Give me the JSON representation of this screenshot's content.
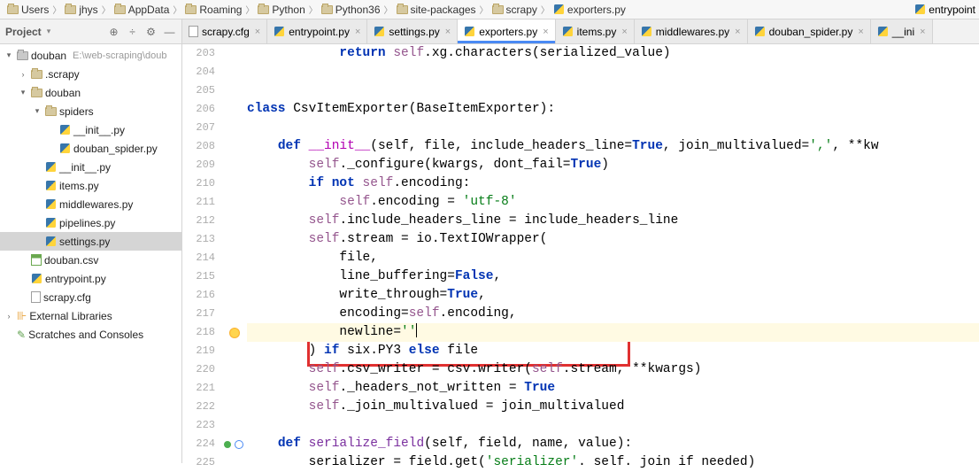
{
  "breadcrumb": {
    "items": [
      "Users",
      "jhys",
      "AppData",
      "Roaming",
      "Python",
      "Python36",
      "site-packages",
      "scrapy"
    ],
    "file": "exporters.py",
    "right": "entrypoint"
  },
  "projectHeader": {
    "title": "Project",
    "dropdown": "▾"
  },
  "tabs": [
    {
      "label": "scrapy.cfg",
      "type": "file",
      "active": false
    },
    {
      "label": "entrypoint.py",
      "type": "py",
      "active": false
    },
    {
      "label": "settings.py",
      "type": "py",
      "active": false
    },
    {
      "label": "exporters.py",
      "type": "py",
      "active": true
    },
    {
      "label": "items.py",
      "type": "py",
      "active": false
    },
    {
      "label": "middlewares.py",
      "type": "py",
      "active": false
    },
    {
      "label": "douban_spider.py",
      "type": "py",
      "active": false
    },
    {
      "label": "__ini",
      "type": "py",
      "active": false
    }
  ],
  "tree": [
    {
      "depth": 0,
      "twisty": "▾",
      "icon": "folder-proj",
      "label": "douban",
      "muted": "E:\\web-scraping\\doub"
    },
    {
      "depth": 1,
      "twisty": "›",
      "icon": "folder",
      "label": ".scrapy",
      "muted": ""
    },
    {
      "depth": 1,
      "twisty": "▾",
      "icon": "folder",
      "label": "douban",
      "muted": ""
    },
    {
      "depth": 2,
      "twisty": "▾",
      "icon": "folder",
      "label": "spiders",
      "muted": ""
    },
    {
      "depth": 3,
      "twisty": "",
      "icon": "py",
      "label": "__init__.py",
      "muted": ""
    },
    {
      "depth": 3,
      "twisty": "",
      "icon": "py",
      "label": "douban_spider.py",
      "muted": ""
    },
    {
      "depth": 2,
      "twisty": "",
      "icon": "py",
      "label": "__init__.py",
      "muted": ""
    },
    {
      "depth": 2,
      "twisty": "",
      "icon": "py",
      "label": "items.py",
      "muted": ""
    },
    {
      "depth": 2,
      "twisty": "",
      "icon": "py",
      "label": "middlewares.py",
      "muted": ""
    },
    {
      "depth": 2,
      "twisty": "",
      "icon": "py",
      "label": "pipelines.py",
      "muted": ""
    },
    {
      "depth": 2,
      "twisty": "",
      "icon": "py",
      "label": "settings.py",
      "muted": "",
      "selected": true
    },
    {
      "depth": 1,
      "twisty": "",
      "icon": "csv",
      "label": "douban.csv",
      "muted": ""
    },
    {
      "depth": 1,
      "twisty": "",
      "icon": "py",
      "label": "entrypoint.py",
      "muted": ""
    },
    {
      "depth": 1,
      "twisty": "",
      "icon": "file",
      "label": "scrapy.cfg",
      "muted": ""
    },
    {
      "depth": 0,
      "twisty": "›",
      "icon": "lib",
      "label": "External Libraries",
      "muted": ""
    },
    {
      "depth": 0,
      "twisty": "",
      "icon": "scratch",
      "label": "Scratches and Consoles",
      "muted": ""
    }
  ],
  "lineStart": 203,
  "code": {
    "l203": {
      "pre": "            ",
      "kw1": "return ",
      "self": "self",
      "t1": ".xg.characters(serialized_value)"
    },
    "l204": "",
    "l205": "",
    "l206": {
      "kw": "class ",
      "name": "CsvItemExporter",
      "rest": "(BaseItemExporter):"
    },
    "l207": "",
    "l208": {
      "pre": "    ",
      "kw": "def ",
      "fn": "__init__",
      "sig1": "(self, file, include_headers_line=",
      "true": "True",
      "sig2": ", join_multivalued=",
      "str": "','",
      "sig3": ", **kw"
    },
    "l209": {
      "pre": "        ",
      "self": "self",
      "t": "._configure(kwargs, dont_fail=",
      "true": "True",
      "t2": ")"
    },
    "l210": {
      "pre": "        ",
      "kw": "if not ",
      "self": "self",
      "t": ".encoding:"
    },
    "l211": {
      "pre": "            ",
      "self": "self",
      "t": ".encoding = ",
      "str": "'utf-8'"
    },
    "l212": {
      "pre": "        ",
      "self": "self",
      "t": ".include_headers_line = include_headers_line"
    },
    "l213": {
      "pre": "        ",
      "self": "self",
      "t": ".stream = io.TextIOWrapper("
    },
    "l214": {
      "pre": "            ",
      "t": "file,"
    },
    "l215": {
      "pre": "            ",
      "t": "line_buffering=",
      "kw": "False",
      "t2": ","
    },
    "l216": {
      "pre": "            ",
      "t": "write_through=",
      "kw": "True",
      "t2": ","
    },
    "l217": {
      "pre": "            ",
      "t": "encoding=",
      "self": "self",
      "t2": ".encoding,"
    },
    "l218": {
      "pre": "            ",
      "t": "newline=",
      "str": "''"
    },
    "l219": {
      "pre": "        ",
      "t": ") ",
      "kw": "if ",
      "t2": "six.PY3 ",
      "kw2": "else ",
      "t3": "file"
    },
    "l220": {
      "pre": "        ",
      "self": "self",
      "t": ".csv_writer = csv.writer(",
      "self2": "self",
      "t2": ".stream, **kwargs)"
    },
    "l221": {
      "pre": "        ",
      "self": "self",
      "t": "._headers_not_written = ",
      "kw": "True"
    },
    "l222": {
      "pre": "        ",
      "self": "self",
      "t": "._join_multivalued = join_multivalued"
    },
    "l223": "",
    "l224": {
      "pre": "    ",
      "kw": "def ",
      "fn": "serialize_field",
      "sig": "(self, field, name, value):"
    },
    "l225": {
      "pre": "        ",
      "t": "serializer = field.get(",
      "str": "'serializer'",
      "t2": ". self. join if needed)"
    }
  }
}
